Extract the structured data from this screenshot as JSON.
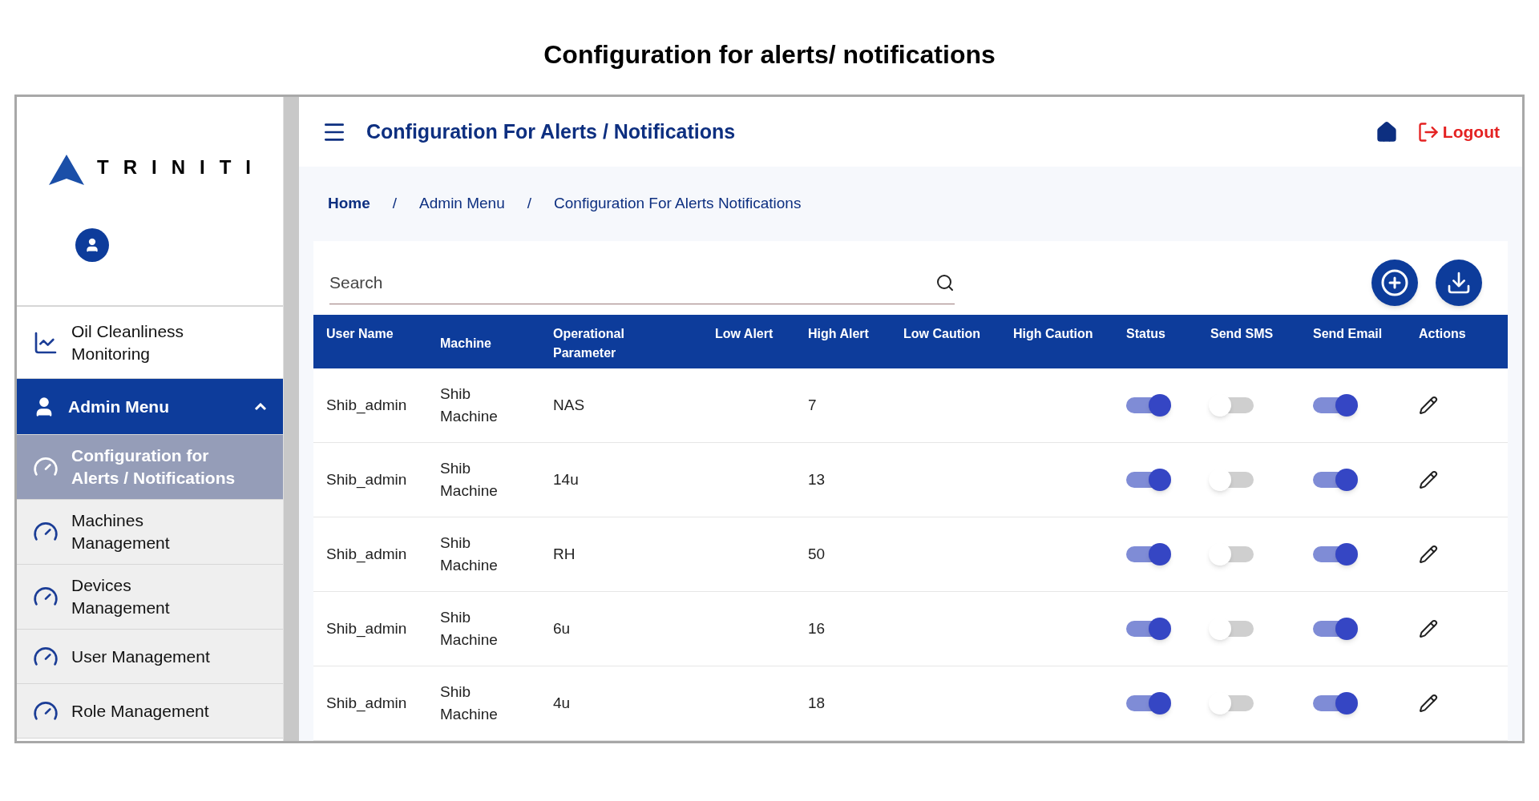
{
  "page_title": "Configuration for alerts/ notifications",
  "sidebar": {
    "logo_text": "TRINITI",
    "items": [
      {
        "label": "Oil Cleanliness Monitoring",
        "kind": "chart",
        "selected": false
      },
      {
        "label": "Admin Menu",
        "kind": "group",
        "selected": true,
        "expanded": true,
        "children": [
          {
            "label": "Configuration for Alerts / Notifications",
            "selected": true
          },
          {
            "label": "Machines Management",
            "selected": false
          },
          {
            "label": "Devices Management",
            "selected": false
          },
          {
            "label": "User Management",
            "selected": false
          },
          {
            "label": "Role Management",
            "selected": false
          }
        ]
      }
    ]
  },
  "header": {
    "title": "Configuration For Alerts / Notifications",
    "logout": "Logout"
  },
  "breadcrumb": {
    "separator": "/",
    "items": [
      "Home",
      "Admin Menu",
      "Configuration For Alerts Notifications"
    ]
  },
  "search": {
    "placeholder": "Search"
  },
  "table": {
    "columns": [
      "User Name",
      "Machine",
      "Operational Parameter",
      "Low Alert",
      "High Alert",
      "Low Caution",
      "High Caution",
      "Status",
      "Send SMS",
      "Send Email",
      "Actions"
    ],
    "rows": [
      {
        "user": "Shib_admin",
        "machine": "Shib Machine",
        "parameter": "NAS",
        "high_alert": "7",
        "status": true,
        "sms": false,
        "email": true
      },
      {
        "user": "Shib_admin",
        "machine": "Shib Machine",
        "parameter": "14u",
        "high_alert": "13",
        "status": true,
        "sms": false,
        "email": true
      },
      {
        "user": "Shib_admin",
        "machine": "Shib Machine",
        "parameter": "RH",
        "high_alert": "50",
        "status": true,
        "sms": false,
        "email": true
      },
      {
        "user": "Shib_admin",
        "machine": "Shib Machine",
        "parameter": "6u",
        "high_alert": "16",
        "status": true,
        "sms": false,
        "email": true
      },
      {
        "user": "Shib_admin",
        "machine": "Shib Machine",
        "parameter": "4u",
        "high_alert": "18",
        "status": true,
        "sms": false,
        "email": true
      }
    ]
  }
}
